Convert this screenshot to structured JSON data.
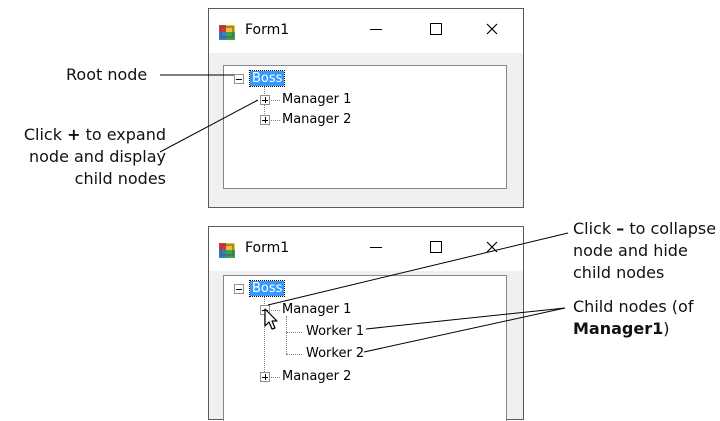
{
  "callouts": {
    "root_node": "Root node",
    "expand_1": "Click",
    "expand_sym": "+",
    "expand_2": "to expand",
    "expand_3": "node and display",
    "expand_4": "child nodes",
    "collapse_1": "Click",
    "collapse_sym": "–",
    "collapse_2": "to collapse",
    "collapse_3": "node and hide",
    "collapse_4": "child nodes",
    "child_1": "Child nodes (of",
    "child_bold": "Manager1",
    "child_end": ")"
  },
  "window_top": {
    "title": "Form1",
    "controls": {
      "minimize": "—",
      "maximize": "☐",
      "close": "✕"
    },
    "tree": [
      {
        "label": "Boss",
        "state": "expanded",
        "selected": true
      },
      {
        "label": "Manager 1",
        "state": "collapsed"
      },
      {
        "label": "Manager 2",
        "state": "collapsed"
      }
    ]
  },
  "window_bottom": {
    "title": "Form1",
    "controls": {
      "minimize": "—",
      "maximize": "☐",
      "close": "✕"
    },
    "tree": [
      {
        "label": "Boss",
        "state": "expanded",
        "selected": true
      },
      {
        "label": "Manager 1",
        "state": "expanded"
      },
      {
        "label": "Worker 1",
        "state": "leaf"
      },
      {
        "label": "Worker 2",
        "state": "leaf"
      },
      {
        "label": "Manager 2",
        "state": "collapsed"
      }
    ]
  },
  "icons": {
    "app": "form-app-icon",
    "cursor": "mouse-cursor-icon"
  }
}
